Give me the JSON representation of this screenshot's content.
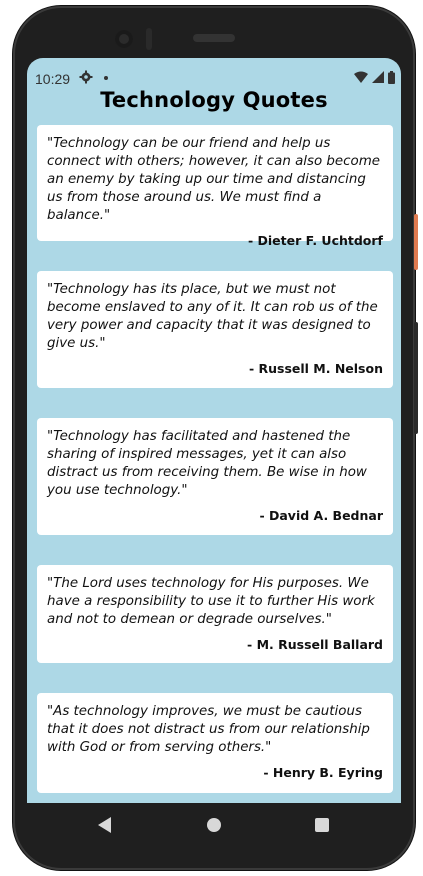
{
  "status_bar": {
    "time": "10:29",
    "icons": [
      "gear-icon",
      "notification-dot-icon",
      "wifi-icon",
      "signal-icon",
      "battery-icon"
    ]
  },
  "app": {
    "title": "Technology Quotes",
    "background_color": "#add8e6"
  },
  "quotes": [
    {
      "text": "\"Technology can be our friend and help us connect with others; however, it can also become an enemy by taking up our time and distancing us from those around us. We must find a balance.\"",
      "author": "- Dieter F. Uchtdorf"
    },
    {
      "text": "\"Technology has its place, but we must not become enslaved to any of it. It can rob us of the very power and capacity that it was designed to give us.\"",
      "author": "- Russell M. Nelson"
    },
    {
      "text": "\"Technology has facilitated and hastened the sharing of inspired messages, yet it can also distract us from receiving them. Be wise in how you use technology.\"",
      "author": "- David A. Bednar"
    },
    {
      "text": "\"The Lord uses technology for His purposes. We have a responsibility to use it to further His work and not to demean or degrade ourselves.\"",
      "author": "- M. Russell Ballard"
    },
    {
      "text": "\"As technology improves, we must be cautious that it does not distract us from our relationship with God or from serving others.\"",
      "author": "- Henry B. Eyring"
    }
  ],
  "nav_bar": {
    "icons": [
      "back-icon",
      "home-icon",
      "recents-icon"
    ]
  }
}
